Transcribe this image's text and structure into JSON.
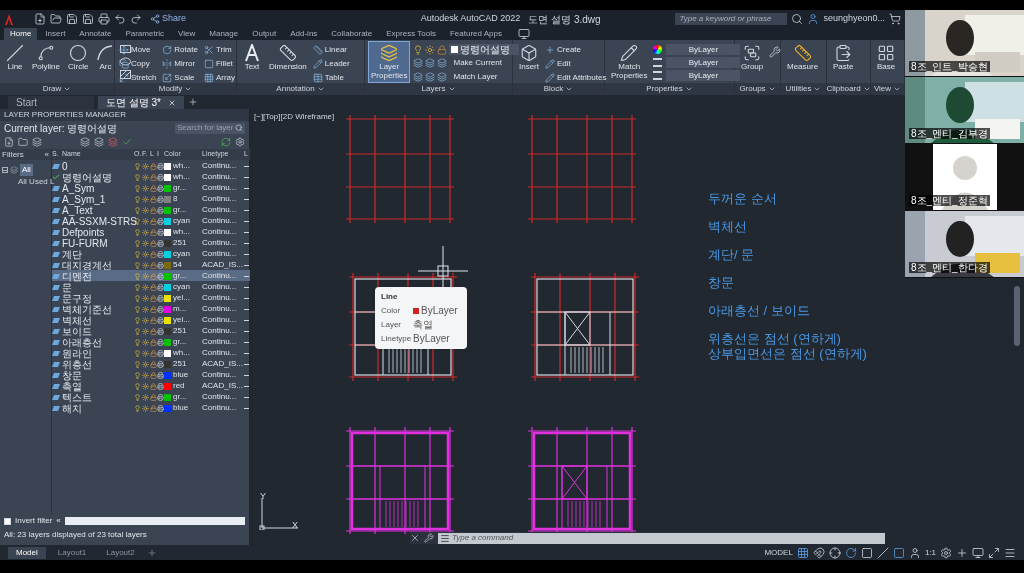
{
  "title_bar": {
    "share": "Share",
    "app": "Autodesk AutoCAD 2022",
    "file": "도면 설명 3.dwg",
    "search_placeholder": "Type a keyword or phrase",
    "user": "seunghyeon0..."
  },
  "ribbon_tabs": [
    {
      "label": "Home",
      "selected": true
    },
    {
      "label": "Insert",
      "selected": false
    },
    {
      "label": "Annotate",
      "selected": false
    },
    {
      "label": "Parametric",
      "selected": false
    },
    {
      "label": "View",
      "selected": false
    },
    {
      "label": "Manage",
      "selected": false
    },
    {
      "label": "Output",
      "selected": false
    },
    {
      "label": "Add-ins",
      "selected": false
    },
    {
      "label": "Collaborate",
      "selected": false
    },
    {
      "label": "Express Tools",
      "selected": false
    },
    {
      "label": "Featured Apps",
      "selected": false
    }
  ],
  "ribbon": [
    {
      "kind": "draw",
      "title": "Draw",
      "large": [
        {
          "label": "Line",
          "active": false
        },
        {
          "label": "Polyline",
          "active": false
        },
        {
          "label": "Circle",
          "active": false
        },
        {
          "label": "Arc",
          "active": false
        }
      ]
    },
    {
      "kind": "modify",
      "title": "Modify",
      "small": [
        "Move",
        "Copy",
        "Stretch",
        "Rotate",
        "Mirror",
        "Scale",
        "Trim",
        "Fillet",
        "Array"
      ]
    },
    {
      "kind": "annotation",
      "title": "Annotation",
      "large": [
        {
          "label": "Text",
          "active": false
        },
        {
          "label": "Dimension",
          "active": false
        }
      ],
      "small": [
        "Linear",
        "Leader",
        "Table"
      ]
    },
    {
      "kind": "layers",
      "title": "Layers",
      "large": [
        {
          "label": "Layer Properties",
          "active": true
        }
      ],
      "dropdown": "명령어설명",
      "small": [
        "Make Current",
        "Match Layer"
      ]
    },
    {
      "kind": "block",
      "title": "Block",
      "large": [
        {
          "label": "Insert",
          "active": false
        }
      ],
      "small": [
        "Create",
        "Edit",
        "Edit Attributes"
      ]
    },
    {
      "kind": "properties",
      "title": "Properties",
      "large": [
        {
          "label": "Match Properties",
          "active": false
        }
      ],
      "dropdowns": [
        "ByLayer",
        "ByLayer",
        "ByLayer"
      ]
    },
    {
      "kind": "groups",
      "title": "Groups",
      "large": [
        {
          "label": "Group",
          "active": false
        }
      ]
    },
    {
      "kind": "utilities",
      "title": "Utilities",
      "large": [
        {
          "label": "Measure",
          "active": false
        }
      ]
    },
    {
      "kind": "clipboard",
      "title": "Clipboard",
      "large": [
        {
          "label": "Paste",
          "active": false
        }
      ]
    },
    {
      "kind": "view",
      "title": "View",
      "large": [
        {
          "label": "Base",
          "active": false
        }
      ]
    }
  ],
  "doc_tabs": [
    {
      "label": "Start",
      "selected": false
    },
    {
      "label": "도면 설명 3*",
      "selected": true
    }
  ],
  "layer_manager": {
    "title": "LAYER PROPERTIES MANAGER",
    "current_layer": "Current layer: 명령어설명",
    "search_placeholder": "Search for layer",
    "filters_label": "Filters",
    "filters": [
      {
        "label": "All",
        "selected": true,
        "expanded": true,
        "children": [
          {
            "label": "All Used L",
            "selected": false
          }
        ]
      }
    ],
    "columns": [
      "S.",
      "Name",
      "O.",
      "F.",
      "L",
      "I",
      "Color",
      "Linetype",
      "L"
    ],
    "layers": [
      {
        "name": "0",
        "current": false,
        "selected": false,
        "color": "#ffffff",
        "color_name": "wh...",
        "linetype": "Continu..."
      },
      {
        "name": "명령어설명",
        "current": true,
        "selected": false,
        "color": "#ffffff",
        "color_name": "wh...",
        "linetype": "Continu..."
      },
      {
        "name": "A_Sym",
        "current": false,
        "selected": false,
        "color": "#00c000",
        "color_name": "gr...",
        "linetype": "Continu..."
      },
      {
        "name": "A_Sym_1",
        "current": false,
        "selected": false,
        "color": "#808080",
        "color_name": "8",
        "linetype": "Continu..."
      },
      {
        "name": "A_Text",
        "current": false,
        "selected": false,
        "color": "#00c000",
        "color_name": "gr...",
        "linetype": "Continu..."
      },
      {
        "name": "AA-SSXM-STRS",
        "current": false,
        "selected": false,
        "color": "#00d0e0",
        "color_name": "cyan",
        "linetype": "Continu..."
      },
      {
        "name": "Defpoints",
        "current": false,
        "selected": false,
        "color": "#ffffff",
        "color_name": "wh...",
        "linetype": "Continu..."
      },
      {
        "name": "FU-FURM",
        "current": false,
        "selected": false,
        "color": "#333333",
        "color_name": "251",
        "linetype": "Continu..."
      },
      {
        "name": "계단",
        "current": false,
        "selected": false,
        "color": "#00d0e0",
        "color_name": "cyan",
        "linetype": "Continu..."
      },
      {
        "name": "대지경계선",
        "current": false,
        "selected": false,
        "color": "#7a6a10",
        "color_name": "54",
        "linetype": "ACAD_IS..."
      },
      {
        "name": "디멘전",
        "current": false,
        "selected": true,
        "color": "#00c000",
        "color_name": "gr...",
        "linetype": "Continu..."
      },
      {
        "name": "문",
        "current": false,
        "selected": false,
        "color": "#00d0e0",
        "color_name": "cyan",
        "linetype": "Continu..."
      },
      {
        "name": "문구정",
        "current": false,
        "selected": false,
        "color": "#e8e000",
        "color_name": "yel...",
        "linetype": "Continu..."
      },
      {
        "name": "벽체기준선",
        "current": false,
        "selected": false,
        "color": "#e000e0",
        "color_name": "m...",
        "linetype": "Continu..."
      },
      {
        "name": "벽체선",
        "current": false,
        "selected": false,
        "color": "#e8e000",
        "color_name": "yel...",
        "linetype": "Continu..."
      },
      {
        "name": "보이드",
        "current": false,
        "selected": false,
        "color": "#333333",
        "color_name": "251",
        "linetype": "Continu..."
      },
      {
        "name": "아래층선",
        "current": false,
        "selected": false,
        "color": "#00c000",
        "color_name": "gr...",
        "linetype": "Continu..."
      },
      {
        "name": "원라인",
        "current": false,
        "selected": false,
        "color": "#ffffff",
        "color_name": "wh...",
        "linetype": "Continu..."
      },
      {
        "name": "위층선",
        "current": false,
        "selected": false,
        "color": "#333333",
        "color_name": "251",
        "linetype": "ACAD_IS..."
      },
      {
        "name": "창문",
        "current": false,
        "selected": false,
        "color": "#0030ff",
        "color_name": "blue",
        "linetype": "Continu..."
      },
      {
        "name": "축열",
        "current": false,
        "selected": false,
        "color": "#ff0000",
        "color_name": "red",
        "linetype": "ACAD_IS..."
      },
      {
        "name": "텍스트",
        "current": false,
        "selected": false,
        "color": "#00c000",
        "color_name": "gr...",
        "linetype": "Continu..."
      },
      {
        "name": "해치",
        "current": false,
        "selected": false,
        "color": "#0030ff",
        "color_name": "blue",
        "linetype": "Continu..."
      }
    ],
    "invert_filter": {
      "label": "Invert filter",
      "checked": false
    },
    "collapse": "«",
    "status": "All: 23 layers displayed of 23 total layers"
  },
  "viewport_label": "[−][Top][2D Wireframe]",
  "tooltip": {
    "title": "Line",
    "rows": [
      {
        "label": "Color",
        "value": "ByLayer",
        "color": "#d02020"
      },
      {
        "label": "Layer",
        "value": "축열"
      },
      {
        "label": "Linetype",
        "value": "ByLayer"
      }
    ]
  },
  "notes": [
    [
      "두꺼운 순서"
    ],
    [
      "벽체선"
    ],
    [
      "계단/ 문"
    ],
    [
      "창문"
    ],
    [
      "아래층선 / 보이드"
    ],
    [
      "위층선은 점선 (연하게)",
      "상부입면선은 점선 (연하게)"
    ]
  ],
  "axes": {
    "y": "Y",
    "x": "X"
  },
  "command_placeholder": "Type a command",
  "layout_tabs": [
    {
      "label": "Model",
      "selected": true
    },
    {
      "label": "Layout1",
      "selected": false
    },
    {
      "label": "Layout2",
      "selected": false
    }
  ],
  "status_bar": {
    "mode": "MODEL",
    "scale": "1:1"
  },
  "participants": [
    {
      "name": "8조_인트_박승현",
      "kind": "video"
    },
    {
      "name": "8조_멘티_김부경",
      "kind": "video"
    },
    {
      "name": "8조_멘티_정준혁",
      "kind": "avatar"
    },
    {
      "name": "8조_멘티_한다경",
      "kind": "video"
    }
  ]
}
